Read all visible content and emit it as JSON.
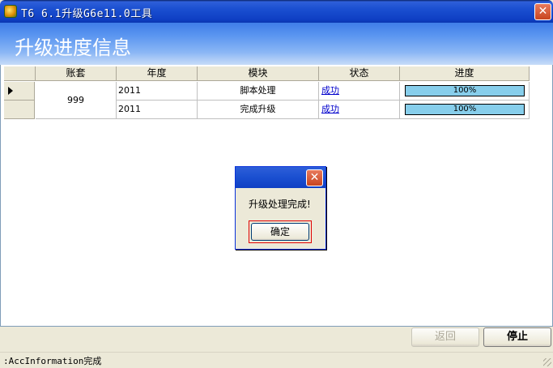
{
  "window": {
    "title": "T6 6.1升级G6e11.0工具"
  },
  "banner": {
    "title": "升级进度信息"
  },
  "grid": {
    "columns": [
      "账套",
      "年度",
      "模块",
      "状态",
      "进度"
    ],
    "account": "999",
    "rows": [
      {
        "year": "2011",
        "module": "脚本处理",
        "status": "成功",
        "progress_label": "100%",
        "progress": 1.0
      },
      {
        "year": "2011",
        "module": "完成升级",
        "status": "成功",
        "progress_label": "100%",
        "progress": 1.0
      }
    ]
  },
  "dialog": {
    "message": "升级处理完成!",
    "ok_label": "确定"
  },
  "buttons": {
    "back_label": "返回",
    "stop_label": "停止"
  },
  "status": {
    "text": ":AccInformation完成"
  },
  "colors": {
    "progress_fill": "#87ceeb",
    "link": "#0000cc",
    "titlebar": "#1a4fd0"
  }
}
